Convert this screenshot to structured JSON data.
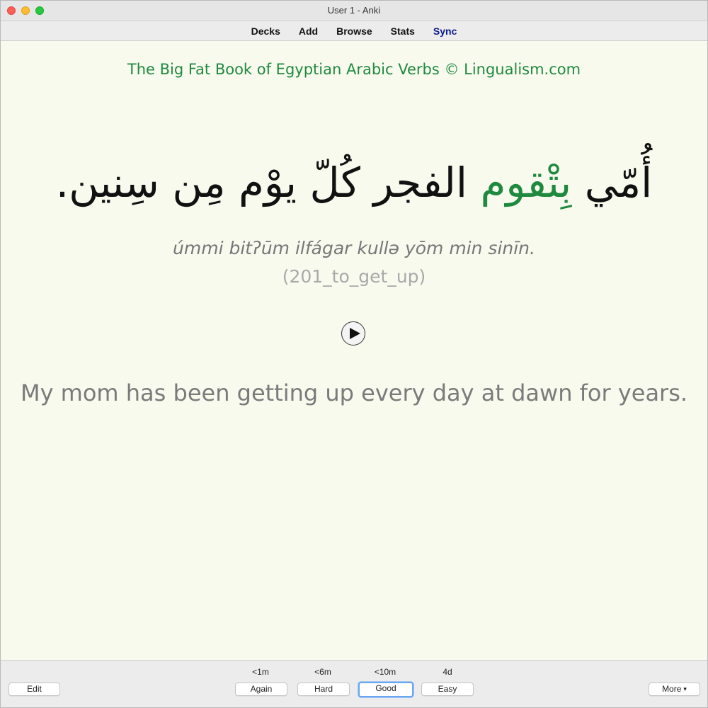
{
  "window": {
    "title": "User 1 - Anki"
  },
  "toolbar": {
    "decks": "Decks",
    "add": "Add",
    "browse": "Browse",
    "stats": "Stats",
    "sync": "Sync"
  },
  "card": {
    "book_title": "The Big Fat Book of Egyptian Arabic Verbs © Lingualism.com",
    "arabic_before": "أُمّي ",
    "arabic_highlight": "بِتْقوم",
    "arabic_after": " الفجر كُلّ يوْم مِن سِنين.",
    "transliteration": "úmmi bitʔūm ilfágar kullə yōm min sinīn.",
    "tag": "(201_to_get_up)",
    "translation": "My mom has been getting up every day at dawn for years."
  },
  "bottombar": {
    "edit": "Edit",
    "more": "More",
    "answers": [
      {
        "interval": "<1m",
        "label": "Again"
      },
      {
        "interval": "<6m",
        "label": "Hard"
      },
      {
        "interval": "<10m",
        "label": "Good"
      },
      {
        "interval": "4d",
        "label": "Easy"
      }
    ]
  },
  "colors": {
    "card_background": "#f9faee",
    "accent_green": "#1f8a3f",
    "sync_blue": "#0b1a8c"
  },
  "icons": {
    "play": "play-icon",
    "more_caret": "caret-down-icon"
  }
}
